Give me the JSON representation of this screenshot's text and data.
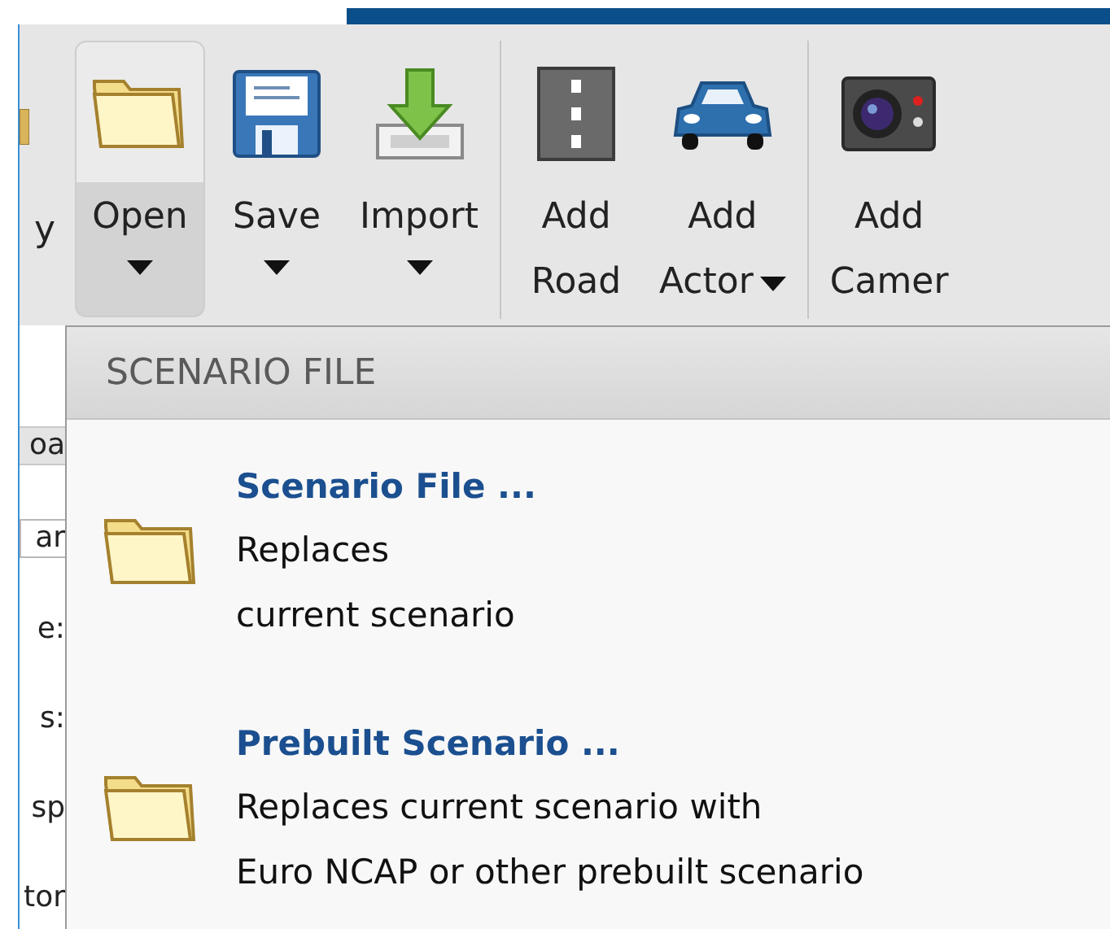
{
  "toolbar": {
    "cut_label": "y",
    "sections": [
      {
        "buttons": [
          {
            "kind": "folder",
            "label_lines": [
              "Open"
            ],
            "dropdown": true,
            "selected": true
          },
          {
            "kind": "disk",
            "label_lines": [
              "Save"
            ],
            "dropdown": true,
            "selected": false
          },
          {
            "kind": "import",
            "label_lines": [
              "Import"
            ],
            "dropdown": true,
            "selected": false
          }
        ]
      },
      {
        "buttons": [
          {
            "kind": "road",
            "label_lines": [
              "Add",
              "Road"
            ],
            "dropdown": false,
            "selected": false
          },
          {
            "kind": "car",
            "label_lines": [
              "Add",
              "Actor"
            ],
            "dropdown": true,
            "selected": false
          }
        ]
      },
      {
        "buttons": [
          {
            "kind": "camera",
            "label_lines": [
              "Add",
              "Camer"
            ],
            "dropdown": false,
            "selected": false
          }
        ]
      }
    ]
  },
  "left_panel": {
    "fragments": [
      {
        "kind": "header",
        "text": "oa"
      },
      {
        "kind": "field",
        "text": "ar"
      },
      {
        "kind": "label",
        "text": "e:"
      },
      {
        "kind": "label",
        "text": "s:"
      },
      {
        "kind": "label",
        "text": "sp"
      },
      {
        "kind": "label",
        "text": "tor"
      }
    ]
  },
  "menu": {
    "header": "SCENARIO FILE",
    "items": [
      {
        "title": "Scenario File ...",
        "description_lines": [
          "Replaces",
          "current scenario"
        ]
      },
      {
        "title": "Prebuilt Scenario ...",
        "description_lines": [
          "Replaces current scenario with",
          "Euro NCAP or other prebuilt scenario"
        ]
      }
    ]
  }
}
